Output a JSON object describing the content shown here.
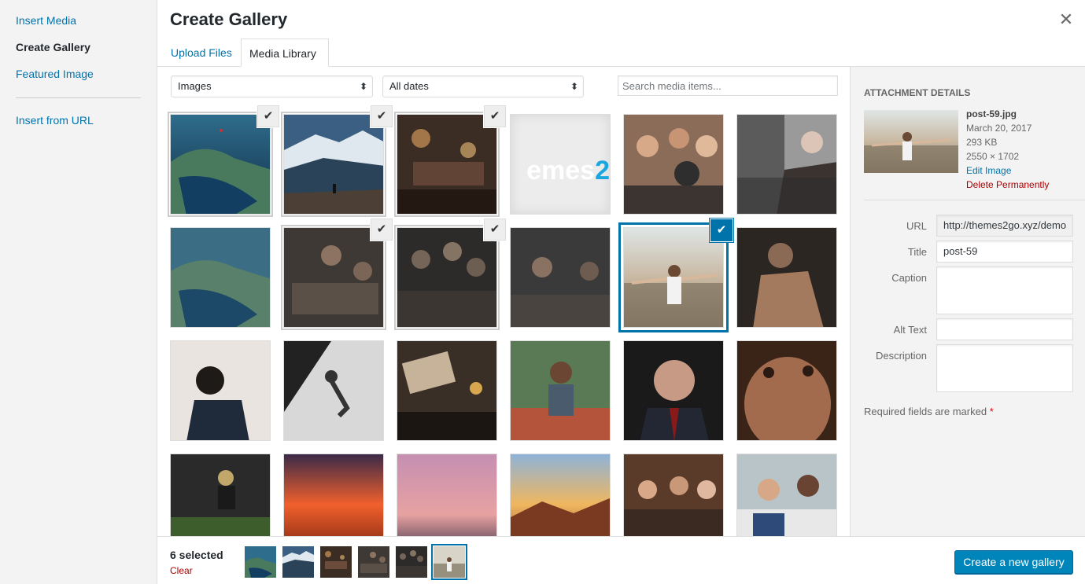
{
  "menu": {
    "items": [
      {
        "label": "Insert Media"
      },
      {
        "label": "Create Gallery",
        "active": true
      },
      {
        "label": "Featured Image"
      },
      {
        "label": "Insert from URL"
      }
    ]
  },
  "modal": {
    "title": "Create Gallery",
    "close_icon": "close-icon"
  },
  "tabs": [
    {
      "label": "Upload Files"
    },
    {
      "label": "Media Library",
      "active": true
    }
  ],
  "toolbar": {
    "type_filter": "Images",
    "date_filter": "All dates",
    "search_placeholder": "Search media items..."
  },
  "grid": {
    "selected_indices": [
      0,
      1,
      2,
      7,
      8,
      10
    ],
    "focused_index": 10,
    "thumbnail_word": {
      "text": "emes",
      "accent": "2"
    }
  },
  "details": {
    "heading": "ATTACHMENT DETAILS",
    "filename": "post-59.jpg",
    "date": "March 20, 2017",
    "size": "293 KB",
    "dimensions": "2550 × 1702",
    "edit_link": "Edit Image",
    "delete_link": "Delete Permanently",
    "fields": {
      "url_label": "URL",
      "url_value": "http://themes2go.xyz/demo",
      "title_label": "Title",
      "title_value": "post-59",
      "caption_label": "Caption",
      "alt_label": "Alt Text",
      "description_label": "Description"
    },
    "required_note": "Required fields are marked",
    "required_star": "*"
  },
  "footer": {
    "selected_count": "6 selected",
    "clear_label": "Clear",
    "primary_button": "Create a new gallery"
  },
  "colors": {
    "accent": "#0073aa",
    "primary_button": "#0085ba",
    "danger": "#aa0000"
  }
}
